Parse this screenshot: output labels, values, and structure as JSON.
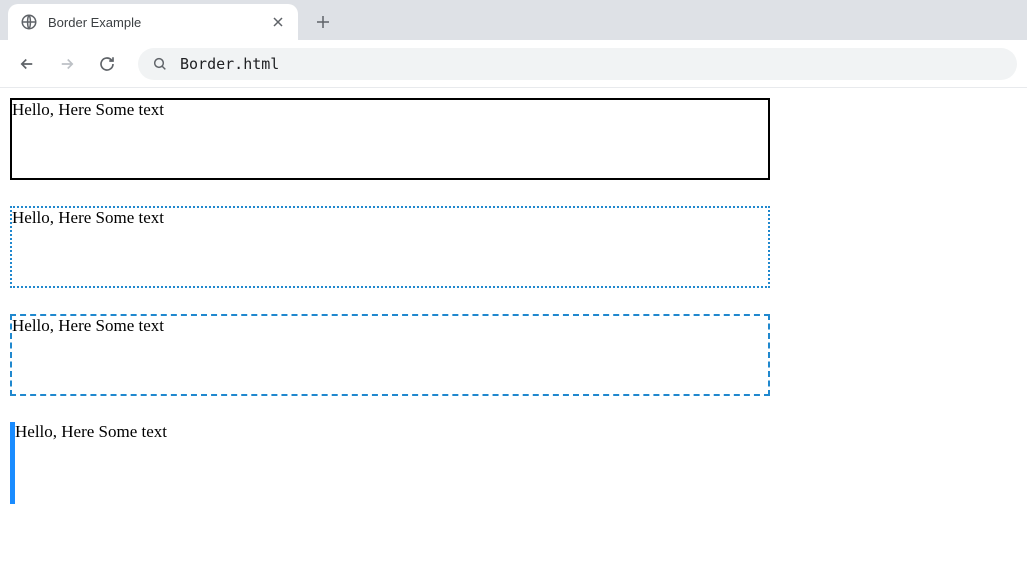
{
  "tab": {
    "title": "Border Example"
  },
  "addressBar": {
    "url": "Border.html"
  },
  "content": {
    "box1": "Hello, Here Some text",
    "box2": "Hello, Here Some text",
    "box3": "Hello, Here Some text",
    "box4": "Hello, Here Some text"
  }
}
